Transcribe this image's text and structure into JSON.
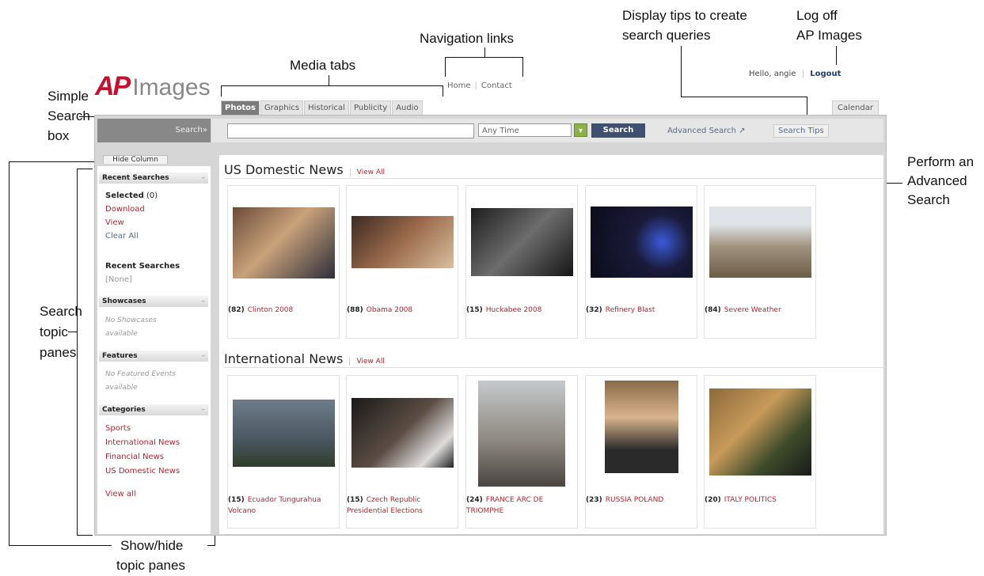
{
  "annotations": {
    "simple_search": [
      "Simple",
      "Search",
      "box"
    ],
    "media_tabs": "Media tabs",
    "navigation_links": "Navigation links",
    "display_tips": [
      "Display tips to create",
      "search queries"
    ],
    "log_off": [
      "Log off",
      "AP Images"
    ],
    "perform_advanced": [
      "Perform an",
      "Advanced",
      "Search"
    ],
    "search_topic_panes": [
      "Search",
      "topic",
      "panes"
    ],
    "show_hide": [
      "Show/hide",
      "topic panes"
    ]
  },
  "logo": {
    "ap": "AP",
    "images": "Images"
  },
  "nav": {
    "home": "Home",
    "contact": "Contact"
  },
  "user": {
    "hello": "Hello, angie",
    "logout": "Logout"
  },
  "tabs": [
    "Photos",
    "Graphics",
    "Historical",
    "Publicity",
    "Audio"
  ],
  "calendar_tab": "Calendar",
  "search": {
    "label": "Search»",
    "query": "",
    "time": "Any Time",
    "button": "Search",
    "advanced": "Advanced Search ↗",
    "tips": "Search Tips"
  },
  "left": {
    "hide_column": "Hide Column",
    "recent_searches_header": "Recent Searches",
    "selected": "Selected",
    "selected_count": "(0)",
    "download": "Download",
    "view": "View",
    "clear_all": "Clear All",
    "recent_searches_title": "Recent Searches",
    "recent_none": "[None]",
    "showcases_header": "Showcases",
    "showcases_empty": [
      "No Showcases",
      "available"
    ],
    "features_header": "Features",
    "features_empty": [
      "No Featured Events",
      "available"
    ],
    "categories_header": "Categories",
    "categories": [
      "Sports",
      "International News",
      "Financial News",
      "US Domestic News"
    ],
    "view_all": "View all"
  },
  "sections": [
    {
      "title": "US Domestic News",
      "view_all": "View All",
      "items": [
        {
          "count": "(82)",
          "name": "Clinton 2008"
        },
        {
          "count": "(88)",
          "name": "Obama 2008"
        },
        {
          "count": "(15)",
          "name": "Huckabee 2008"
        },
        {
          "count": "(32)",
          "name": "Refinery Blast"
        },
        {
          "count": "(84)",
          "name": "Severe Weather"
        }
      ]
    },
    {
      "title": "International News",
      "view_all": "View All",
      "items": [
        {
          "count": "(15)",
          "name": "Ecuador Tungurahua Volcano"
        },
        {
          "count": "(15)",
          "name": "Czech Republic Presidential Elections"
        },
        {
          "count": "(24)",
          "name": "FRANCE ARC DE TRIOMPHE"
        },
        {
          "count": "(23)",
          "name": "RUSSIA POLAND"
        },
        {
          "count": "(20)",
          "name": "ITALY POLITICS"
        }
      ]
    }
  ]
}
